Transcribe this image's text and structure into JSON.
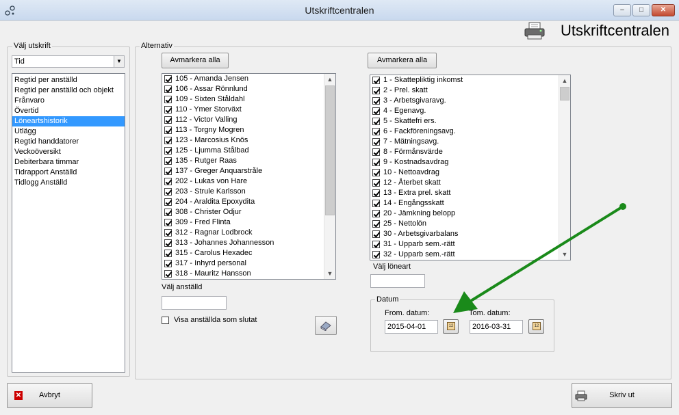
{
  "window": {
    "title": "Utskriftcentralen",
    "minimize": "‒",
    "maximize": "□",
    "close": "✕"
  },
  "header": {
    "title": "Utskriftcentralen",
    "icon": "printer-icon"
  },
  "left_panel": {
    "group_label": "Välj utskrift",
    "dropdown_value": "Tid",
    "items": [
      "Regtid per anställd",
      "Regtid per anställd och objekt",
      "Frånvaro",
      "Övertid",
      "Löneartshistorik",
      "Utlägg",
      "Regtid handdatorer",
      "Veckoöversikt",
      "Debiterbara timmar",
      "Tidrapport Anställd",
      "Tidlogg Anställd"
    ],
    "selected_index": 4
  },
  "alternativ": {
    "group_label": "Alternativ",
    "employees": {
      "deselect_label": "Avmarkera alla",
      "items": [
        "105 - Amanda Jensen",
        "106 - Assar Rönnlund",
        "109 - Sixten Ståldahl",
        "110 - Ymer Storväxt",
        "112 - Victor Valling",
        "113 - Torgny Mogren",
        "123 - Marcosius Knös",
        "125 - Ljumma Stålbad",
        "135 - Rutger Raas",
        "137 - Greger Anquarstråle",
        "202 - Lukas von Hare",
        "203 - Strule Karlsson",
        "204 - Araldita Epoxydita",
        "308 - Christer Odjur",
        "309 - Fred Flinta",
        "312 - Ragnar Lodbrock",
        "313 - Johannes Johannesson",
        "315 - Carolus Hexadec",
        "317 - Inhyrd personal",
        "318 - Mauritz Hansson"
      ],
      "select_label": "Välj anställd",
      "select_value": "",
      "show_ended_label": "Visa anställda som slutat",
      "show_ended_checked": false
    },
    "wage_types": {
      "deselect_label": "Avmarkera alla",
      "items": [
        "1 - Skattepliktig inkomst",
        "2 - Prel. skatt",
        "3 - Arbetsgivaravg.",
        "4 - Egenavg.",
        "5 - Skattefri ers.",
        "6 - Fackföreningsavg.",
        "7 - Mätningsavg.",
        "8 - Förmånsvärde",
        "9 - Kostnadsavdrag",
        "10 - Nettoavdrag",
        "12 - Återbet skatt",
        "13 - Extra prel. skatt",
        "14 - Engångsskatt",
        "20 - Jämkning belopp",
        "25 - Nettolön",
        "30 - Arbetsgivarbalans",
        "31 - Upparb sem.-rätt",
        "32 - Upparb sem.-rätt"
      ],
      "select_label": "Välj löneart",
      "select_value": ""
    },
    "date": {
      "group_label": "Datum",
      "from_label": "From. datum:",
      "from_value": "2015-04-01",
      "to_label": "Tom. datum:",
      "to_value": "2016-03-31",
      "calendar_day": "12"
    }
  },
  "footer": {
    "cancel_label": "Avbryt",
    "print_label": "Skriv ut"
  },
  "colors": {
    "selection": "#3399ff",
    "annotation_arrow": "#1a8a1a",
    "cancel_icon": "#cc0000"
  }
}
